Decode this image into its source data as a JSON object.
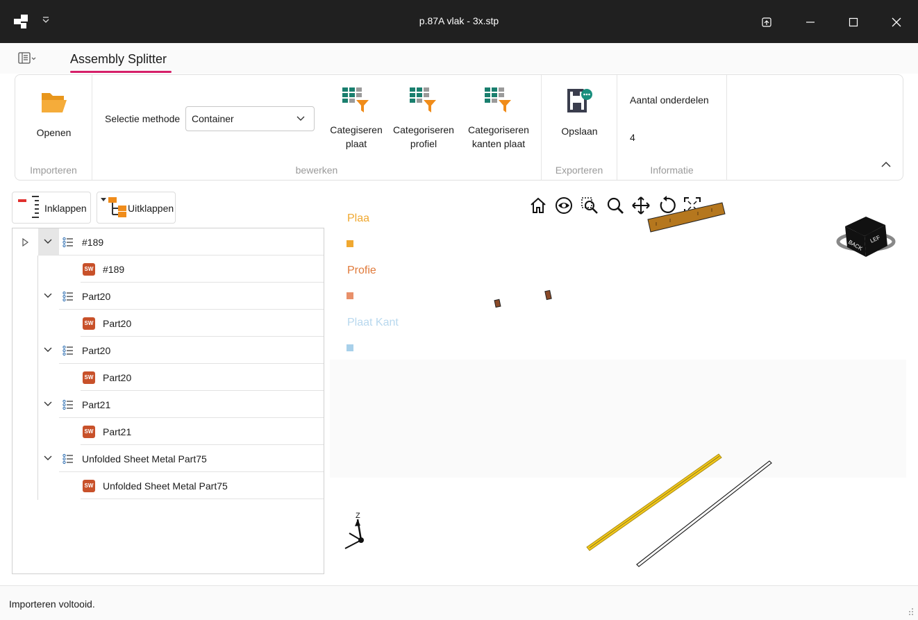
{
  "window": {
    "title": "p.87A vlak - 3x.stp"
  },
  "tabs": [
    {
      "label": "Assembly Splitter",
      "active": true
    }
  ],
  "ribbon": {
    "groups": {
      "importeren": {
        "label": "Importeren",
        "open_label": "Openen"
      },
      "bewerken": {
        "label": "bewerken",
        "selectie_label": "Selectie methode",
        "selectie_value": "Container",
        "cat_plaat_line1": "Categiseren",
        "cat_plaat_line2": "plaat",
        "cat_profiel_line1": "Categoriseren",
        "cat_profiel_line2": "profiel",
        "cat_kanten_line1": "Categoriseren",
        "cat_kanten_line2": "kanten plaat"
      },
      "exporteren": {
        "label": "Exporteren",
        "save_label": "Opslaan"
      },
      "informatie": {
        "label": "Informatie",
        "count_title": "Aantal onderdelen",
        "count_value": "4"
      }
    }
  },
  "tree_toolbar": {
    "collapse_label": "Inklappen",
    "expand_label": "Uitklappen"
  },
  "tree": {
    "items": [
      {
        "label": "#189",
        "level": 0
      },
      {
        "label": "#189",
        "level": 1
      },
      {
        "label": "Part20",
        "level": 0
      },
      {
        "label": "Part20",
        "level": 1
      },
      {
        "label": "Part20",
        "level": 0
      },
      {
        "label": "Part20",
        "level": 1
      },
      {
        "label": "Part21",
        "level": 0
      },
      {
        "label": "Part21",
        "level": 1
      },
      {
        "label": "Unfolded Sheet Metal Part75",
        "level": 0
      },
      {
        "label": "Unfolded Sheet Metal Part75",
        "level": 1
      }
    ]
  },
  "viewport": {
    "legend": [
      {
        "label": "Plaa",
        "color": "#f0a830"
      },
      {
        "label": "Profie",
        "color": "#e07a3a"
      },
      {
        "label": "Plaat Kant",
        "color": "#a8d0ea"
      }
    ],
    "tools": [
      "home-icon",
      "eye-icon",
      "zoom-window-icon",
      "zoom-icon",
      "pan-icon",
      "rotate-icon",
      "fit-all-icon"
    ],
    "view_cube": {
      "face_top": "BACK",
      "face_right": "LEF"
    },
    "axis_label": "Z"
  },
  "status": {
    "text": "Importeren voltooid."
  },
  "colors": {
    "accent": "#d61f69",
    "titlebar": "#202020",
    "folder": "#f0a830",
    "grid_teal": "#1a7f6e",
    "filter_orange": "#f08c1a"
  }
}
